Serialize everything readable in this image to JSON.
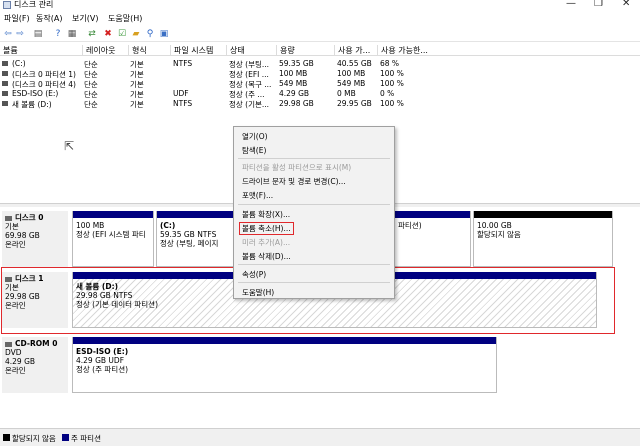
{
  "window": {
    "title": "디스크 관리",
    "controls": [
      "—",
      "❐",
      "✕"
    ]
  },
  "menu": [
    "파일(F)",
    "동작(A)",
    "보기(V)",
    "도움말(H)"
  ],
  "toolbar": {
    "icons": [
      "back-arrow-icon",
      "forward-arrow-icon",
      "disk-list-icon",
      "help-icon",
      "properties-icon",
      "connect-icon",
      "delete-icon",
      "check-icon",
      "folder-icon",
      "search-icon",
      "view-icon"
    ],
    "glyphs": [
      "⇦",
      "⇨",
      "▤",
      "?",
      "▦",
      "⇄",
      "✖",
      "☑",
      "▰",
      "⚲",
      "▣"
    ],
    "colors": [
      "#3a6fc4",
      "#3a6fc4",
      "#555555",
      "#2a64c5",
      "#555555",
      "#3a8a3a",
      "#d42020",
      "#3c9a3c",
      "#d8a020",
      "#2a64c5",
      "#3a6fc4"
    ]
  },
  "volume_table": {
    "headers": [
      "볼륨",
      "레이아웃",
      "형식",
      "파일 시스템",
      "상태",
      "용량",
      "사용 가...",
      "사용 가능한..."
    ],
    "rows": [
      [
        "(C:)",
        "단순",
        "기본",
        "NTFS",
        "정상 (부팅...",
        "59.35 GB",
        "40.55 GB",
        "68 %"
      ],
      [
        "(디스크 0 파티션 1)",
        "단순",
        "기본",
        "",
        "정상 (EFI ...",
        "100 MB",
        "100 MB",
        "100 %"
      ],
      [
        "(디스크 0 파티션 4)",
        "단순",
        "기본",
        "",
        "정상 (복구 ...",
        "549 MB",
        "549 MB",
        "100 %"
      ],
      [
        "ESD-ISO (E:)",
        "단순",
        "기본",
        "UDF",
        "정상 (주 ...",
        "4.29 GB",
        "0 MB",
        "0 %"
      ],
      [
        "새 볼륨 (D:)",
        "단순",
        "기본",
        "NTFS",
        "정상 (기본...",
        "29.98 GB",
        "29.95 GB",
        "100 %"
      ]
    ]
  },
  "disks": [
    {
      "name": "디스크 0",
      "type": "기본",
      "size": "69.98 GB",
      "status": "온라인",
      "partitions": [
        {
          "name": "",
          "line1": "100 MB",
          "line2": "정상 (EFI 시스템 파티"
        },
        {
          "name": "(C:)",
          "line1": "59.35 GB NTFS",
          "line2": "정상 (부팅, 페이지"
        },
        {
          "name": "",
          "line1": "",
          "line2": "파티션)"
        },
        {
          "name": "",
          "line1": "10.00 GB",
          "line2": "할당되지 않음"
        }
      ]
    },
    {
      "name": "디스크 1",
      "type": "기본",
      "size": "29.98 GB",
      "status": "온라인",
      "partitions": [
        {
          "name": "새 볼륨 (D:)",
          "line1": "29.98 GB NTFS",
          "line2": "정상 (기본 데이터 파티션)"
        }
      ]
    },
    {
      "name": "CD-ROM 0",
      "type": "DVD",
      "size": "4.29 GB",
      "status": "온라인",
      "partitions": [
        {
          "name": "ESD-ISO (E:)",
          "line1": "4.29 GB UDF",
          "line2": "정상 (주 파티션)"
        }
      ]
    }
  ],
  "context_menu": {
    "items": [
      {
        "label": "열기(O)",
        "enabled": true
      },
      {
        "label": "탐색(E)",
        "enabled": true
      },
      {
        "label": "파티션을 활성 파티션으로 표시(M)",
        "enabled": false
      },
      {
        "label": "드라이브 문자 및 경로 변경(C)...",
        "enabled": true
      },
      {
        "label": "포맷(F)...",
        "enabled": true
      },
      {
        "label": "볼륨 확장(X)...",
        "enabled": true
      },
      {
        "label": "볼륨 축소(H)...",
        "enabled": true
      },
      {
        "label": "미러 추가(A)...",
        "enabled": false
      },
      {
        "label": "볼륨 삭제(D)...",
        "enabled": true
      },
      {
        "label": "속성(P)",
        "enabled": true
      },
      {
        "label": "도움말(H)",
        "enabled": true
      }
    ]
  },
  "legend": [
    {
      "label": "할당되지 않음",
      "color": "#000000"
    },
    {
      "label": "주 파티션",
      "color": "#000080"
    }
  ]
}
